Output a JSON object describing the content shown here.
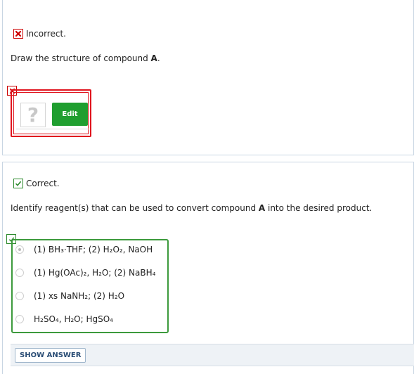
{
  "part1": {
    "status": "Incorrect.",
    "prompt_before": "Draw the structure of compound ",
    "prompt_bold": "A",
    "prompt_after": ".",
    "placeholder_glyph": "?",
    "edit_label": "Edit"
  },
  "part2": {
    "status": "Correct.",
    "prompt_before": "Identify reagent(s) that can be used to convert compound ",
    "prompt_bold": "A",
    "prompt_after": " into the desired product.",
    "options": [
      "(1) BH₃·THF; (2) H₂O₂, NaOH",
      "(1) Hg(OAc)₂, H₂O; (2) NaBH₄",
      "(1) xs NaNH₂; (2) H₂O",
      "H₂SO₄, H₂O; HgSO₄"
    ],
    "selected_index": 0,
    "show_answer_label": "SHOW ANSWER"
  },
  "colors": {
    "incorrect": "#cc0000",
    "correct": "#2d8a2d",
    "edit_button": "#1f9e2f"
  }
}
